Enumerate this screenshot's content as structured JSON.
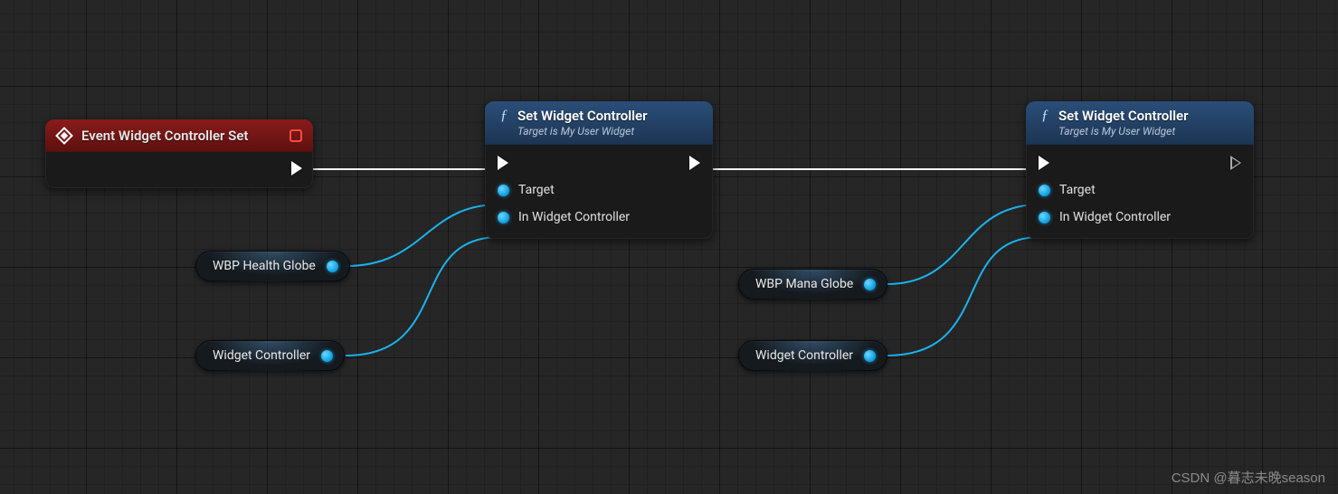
{
  "event_node": {
    "title": "Event Widget Controller Set",
    "icon": "event-diamond-icon",
    "stop_state": "stop-box-icon"
  },
  "func_nodes": [
    {
      "id": "setwc1",
      "title": "Set Widget Controller",
      "subtitle": "Target is My User Widget",
      "pins": {
        "target": "Target",
        "in_controller": "In Widget Controller"
      }
    },
    {
      "id": "setwc2",
      "title": "Set Widget Controller",
      "subtitle": "Target is My User Widget",
      "pins": {
        "target": "Target",
        "in_controller": "In Widget Controller"
      }
    }
  ],
  "var_pills": [
    {
      "id": "health_globe",
      "label": "WBP Health Globe"
    },
    {
      "id": "widget_ctrl1",
      "label": "Widget Controller"
    },
    {
      "id": "mana_globe",
      "label": "WBP Mana Globe"
    },
    {
      "id": "widget_ctrl2",
      "label": "Widget Controller"
    }
  ],
  "colors": {
    "exec_wire": "#f6f6f6",
    "object_wire": "#19b4ef",
    "event_header": "#8a1b1b",
    "func_header": "#2a4e78",
    "background": "#262626"
  },
  "watermark": "CSDN @暮志未晚season"
}
